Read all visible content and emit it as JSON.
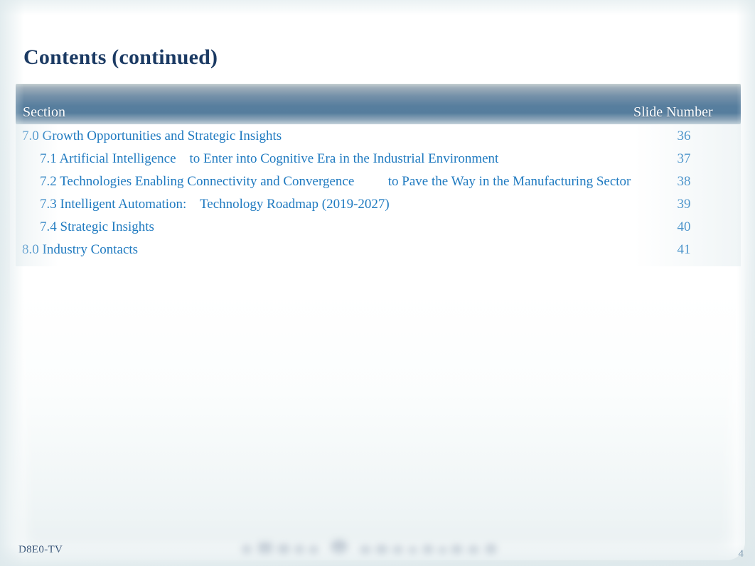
{
  "slide": {
    "title": "Contents (continued)",
    "page_number": "4",
    "footer_code": "D8E0-TV",
    "footer_logo_icon": "blurred-company-logo-watermark",
    "colors": {
      "title_navy": "#1b3a63",
      "link_blue": "#1f7ac0",
      "header_band_blue": "#577e9e",
      "header_text": "#ffffff",
      "page_background": "#ffffff"
    }
  },
  "table": {
    "columns": {
      "section": "Section",
      "slide_number": "Slide Number"
    },
    "rows": [
      {
        "label": "7.0 Growth Opportunities and Strategic Insights",
        "slide": "36",
        "indent": 0
      },
      {
        "label": "7.1 Artificial Intelligence    to Enter into Cognitive Era in the Industrial Environment",
        "slide": "37",
        "indent": 1
      },
      {
        "label": "7.2 Technologies Enabling Connectivity and Convergence          to Pave the Way in the Manufacturing Sector",
        "slide": "38",
        "indent": 1
      },
      {
        "label": "7.3 Intelligent Automation:    Technology Roadmap (2019-2027)",
        "slide": "39",
        "indent": 1
      },
      {
        "label": "7.4 Strategic Insights",
        "slide": "40",
        "indent": 1
      },
      {
        "label": "8.0 Industry Contacts",
        "slide": "41",
        "indent": 0
      }
    ]
  }
}
